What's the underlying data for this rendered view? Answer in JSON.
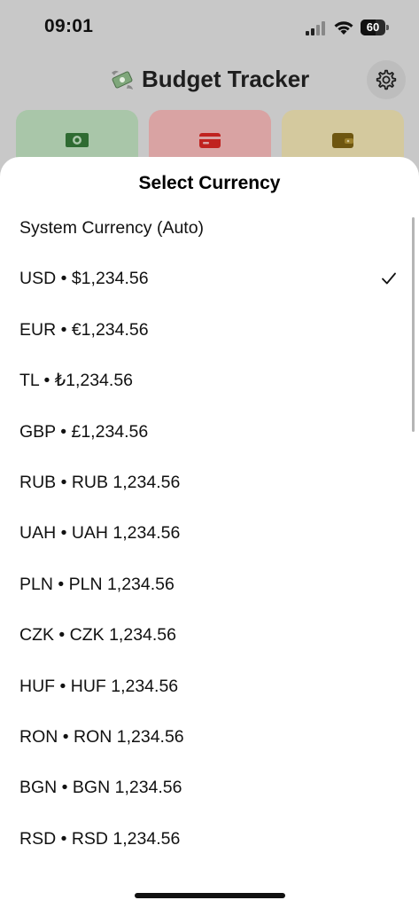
{
  "status_bar": {
    "time": "09:01",
    "battery_level": "60",
    "battery_fraction": 0.6
  },
  "header": {
    "title": "Budget Tracker"
  },
  "cards": [
    {
      "icon": "money-icon",
      "color": "#a9c6a9"
    },
    {
      "icon": "credit-card-icon",
      "color": "#d9a3a3"
    },
    {
      "icon": "wallet-icon",
      "color": "#d4c99e"
    }
  ],
  "sheet": {
    "title": "Select Currency",
    "selected": "USD",
    "items": [
      {
        "code": "AUTO",
        "label": "System Currency (Auto)",
        "selected": false
      },
      {
        "code": "USD",
        "label": "USD • $1,234.56",
        "selected": true
      },
      {
        "code": "EUR",
        "label": "EUR • €1,234.56",
        "selected": false
      },
      {
        "code": "TL",
        "label": "TL • ₺1,234.56",
        "selected": false
      },
      {
        "code": "GBP",
        "label": "GBP • £1,234.56",
        "selected": false
      },
      {
        "code": "RUB",
        "label": "RUB • RUB 1,234.56",
        "selected": false
      },
      {
        "code": "UAH",
        "label": "UAH • UAH 1,234.56",
        "selected": false
      },
      {
        "code": "PLN",
        "label": "PLN • PLN 1,234.56",
        "selected": false
      },
      {
        "code": "CZK",
        "label": "CZK • CZK 1,234.56",
        "selected": false
      },
      {
        "code": "HUF",
        "label": "HUF • HUF 1,234.56",
        "selected": false
      },
      {
        "code": "RON",
        "label": "RON • RON 1,234.56",
        "selected": false
      },
      {
        "code": "BGN",
        "label": "BGN • BGN 1,234.56",
        "selected": false
      },
      {
        "code": "RSD",
        "label": "RSD • RSD 1,234.56",
        "selected": false
      }
    ]
  }
}
